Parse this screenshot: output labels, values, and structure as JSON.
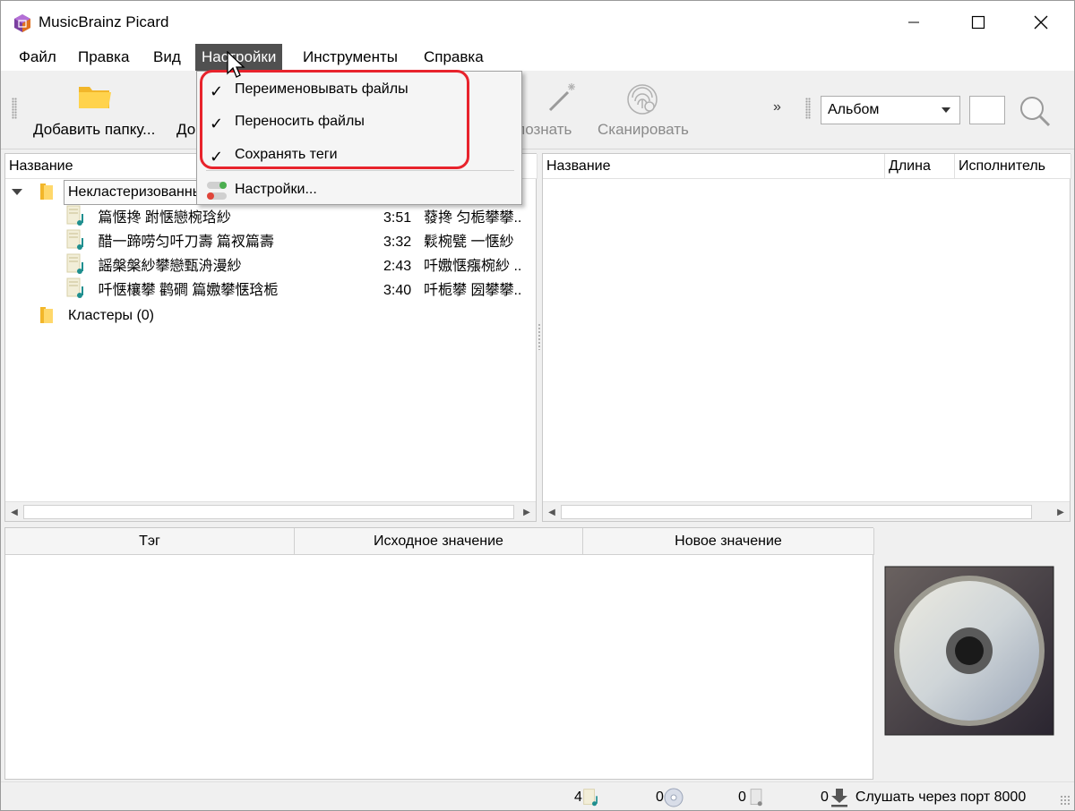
{
  "window": {
    "title": "MusicBrainz Picard"
  },
  "menubar": {
    "items": [
      "Файл",
      "Правка",
      "Вид",
      "Настройки",
      "Инструменты",
      "Справка"
    ]
  },
  "toolbar": {
    "add_folder": "Добавить папку...",
    "add_files_partial": "До",
    "lookup_partial": "познать",
    "scan": "Сканировать",
    "more": "»",
    "mode_selected": "Альбом"
  },
  "settings_menu": {
    "items": [
      {
        "label": "Переименовывать файлы",
        "checked": true
      },
      {
        "label": "Переносить файлы",
        "checked": true
      },
      {
        "label": "Сохранять теги",
        "checked": true
      },
      {
        "label": "Настройки...",
        "checked": false
      }
    ],
    "highlight_color": "#e8232c"
  },
  "left_pane": {
    "header_name": "Название",
    "cluster_label": "Некластеризованные",
    "files": [
      {
        "title": "篇惬搀 跗惬戀椀琀紗",
        "length": "3:51",
        "artist": "蕟搀 匀栀攀攀.."
      },
      {
        "title": "醋一蹄唠匀吀刀壽 篇衩篇壽",
        "length": "3:32",
        "artist": "鬏椀甓 一惬紗"
      },
      {
        "title": "謡槃槃紗攀戀甄洀漫紗",
        "length": "2:43",
        "artist": "吀嫐惬瘬椀紗 .."
      },
      {
        "title": "吀惬欀攀 鹳磵 篇嫐攀惬琀栀",
        "length": "3:40",
        "artist": "吀栀攀 圀攀攀.."
      }
    ],
    "clusters_label": "Кластеры (0)"
  },
  "right_pane": {
    "header_name": "Название",
    "header_length": "Длина",
    "header_artist": "Исполнитель"
  },
  "tag_panel": {
    "header_tag": "Тэг",
    "header_original": "Исходное значение",
    "header_new": "Новое значение"
  },
  "statusbar": {
    "files_count": "4",
    "albums_count": "0",
    "pending_count": "0",
    "requests_count": "0",
    "port_text": "Слушать через порт 8000"
  }
}
